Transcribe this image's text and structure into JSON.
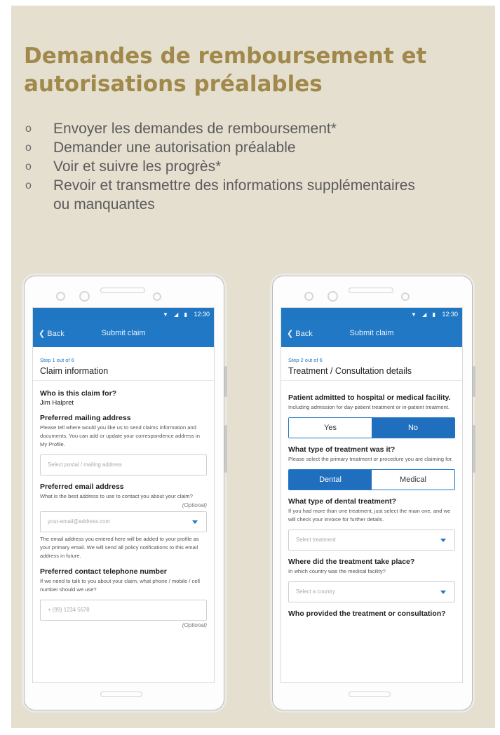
{
  "heading": "Demandes de remboursement et autorisations préalables",
  "bullets": [
    "Envoyer les demandes de remboursement*",
    "Demander une autorisation préalable",
    "Voir et suivre les progrès*",
    "Revoir et transmettre des informations supplémentaires ou manquantes"
  ],
  "bullet_marker": "o",
  "phone1": {
    "status_time": "12:30",
    "status_icons": "▼ ◢ ▮",
    "back_label": "Back",
    "screen_title": "Submit claim",
    "step_label": "Step 1 out of 6",
    "step_heading": "Claim information",
    "claim_for_q": "Who is this claim for?",
    "claim_for_value": "Jim Halpret",
    "mailing_q": "Preferred mailing address",
    "mailing_help": "Please tell where would you like us to send claims information and documents. You can add or update your correspondence address in My Profile.",
    "mailing_placeholder": "Select postal / mailing address",
    "email_q": "Preferred email address",
    "email_help": "What is the best address to use to contact you about your claim?",
    "optional_label": "(Optional)",
    "email_placeholder": "your-email@address.com",
    "email_note": "The email address you entered here will be added to your profile as your primary email. We will send all policy notifications to this email address in future.",
    "phone_q": "Preferred contact telephone number",
    "phone_help": "If we need to talk to you about your claim, what phone / mobile / cell number should we use?",
    "phone_placeholder": "+ (99) 1234 5678",
    "optional_label2": "(Optional)"
  },
  "phone2": {
    "status_time": "12:30",
    "status_icons": "▼ ◢ ▮",
    "back_label": "Back",
    "screen_title": "Submit claim",
    "step_label": "Step 2 out of 6",
    "step_heading": "Treatment / Consultation details",
    "admitted_q": "Patient admitted to hospital or medical facility.",
    "admitted_help": "Including admission for day-patient treatment or in-patient treatment.",
    "yes_label": "Yes",
    "no_label": "No",
    "treatment_type_q": "What type of treatment was it?",
    "treatment_type_help": "Please select the primary treatment or procedure you are claiming for.",
    "dental_label": "Dental",
    "medical_label": "Medical",
    "dental_type_q": "What type of dental treatment?",
    "dental_type_help": "If you had more than one treatment, just select the main one, and we will check your invoice for further details.",
    "treatment_placeholder": "Select treatment",
    "where_q": "Where did the treatment take place?",
    "where_help": "In which country was the medical facility?",
    "country_placeholder": "Select a country",
    "provider_q": "Who provided the treatment or consultation?"
  },
  "colors": {
    "panel_bg": "#e5dfd0",
    "heading": "#a0894a",
    "app_blue": "#2179c6"
  }
}
